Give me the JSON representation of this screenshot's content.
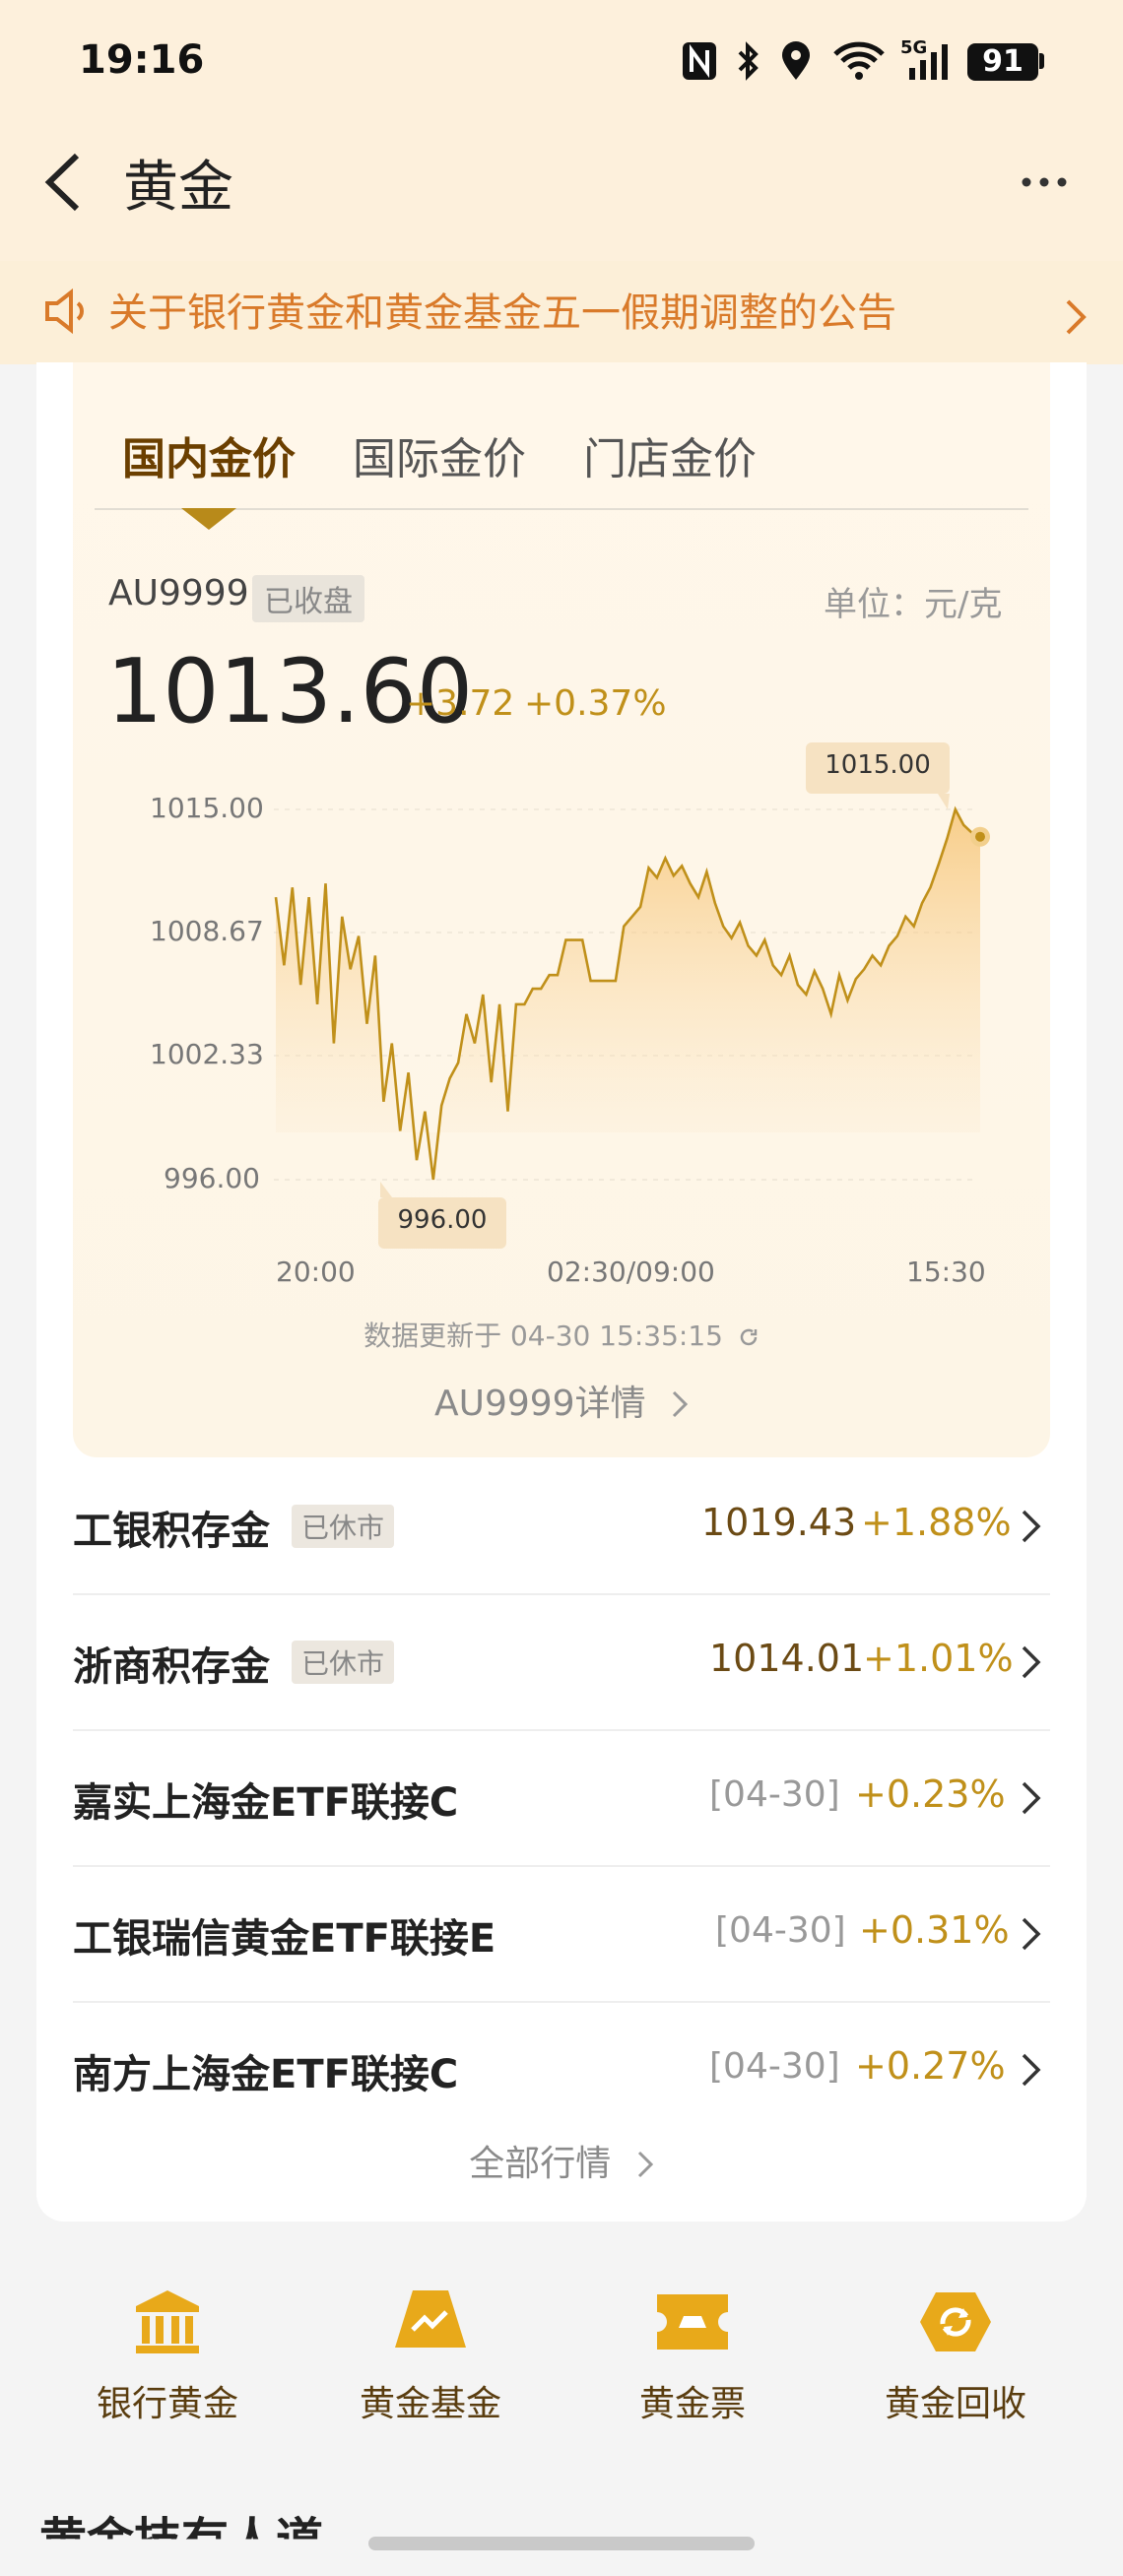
{
  "status_bar": {
    "time": "19:16",
    "network": "5G",
    "battery": "91"
  },
  "header": {
    "title": "黄金"
  },
  "notice": {
    "text": "关于银行黄金和黄金基金五一假期调整的公告"
  },
  "tabs": [
    {
      "label": "国内金价",
      "active": true
    },
    {
      "label": "国际金价",
      "active": false
    },
    {
      "label": "门店金价",
      "active": false
    }
  ],
  "quote": {
    "symbol": "AU9999",
    "market_status": "已收盘",
    "unit": "单位：元/克",
    "price": "1013.60",
    "change": "+3.72",
    "change_pct": "+0.37%"
  },
  "chart_data": {
    "type": "area",
    "y_ticks": [
      "1015.00",
      "1008.67",
      "1002.33",
      "996.00"
    ],
    "x_ticks": [
      "20:00",
      "02:30/09:00",
      "15:30"
    ],
    "ylim": [
      996.0,
      1015.0
    ],
    "max_label": "1015.00",
    "min_label": "996.00",
    "series": [
      {
        "values": [
          1010.5,
          1007.0,
          1011.0,
          1006.0,
          1010.5,
          1005.0,
          1011.2,
          1003.0,
          1009.5,
          1006.8,
          1008.5,
          1004.0,
          1007.5,
          1000.0,
          1003.0,
          998.5,
          1001.5,
          997.0,
          999.5,
          996.0,
          999.8,
          1001.2,
          1002.0,
          1004.5,
          1003.0,
          1005.5,
          1001.0,
          1005.0,
          999.5,
          1005.0,
          1005.0,
          1005.8,
          1005.8,
          1006.5,
          1006.5,
          1008.3,
          1008.3,
          1008.3,
          1006.2,
          1006.2,
          1006.2,
          1006.2,
          1009.0,
          1009.5,
          1010.0,
          1012.0,
          1011.5,
          1012.5,
          1011.6,
          1012.1,
          1011.2,
          1010.5,
          1011.8,
          1010.2,
          1009.0,
          1008.4,
          1009.2,
          1008.0,
          1007.5,
          1008.3,
          1007.0,
          1006.5,
          1007.5,
          1006.0,
          1005.5,
          1006.7,
          1005.8,
          1004.5,
          1006.5,
          1005.2,
          1006.3,
          1006.8,
          1007.5,
          1007.0,
          1008.0,
          1008.5,
          1009.5,
          1009.0,
          1010.2,
          1011.0,
          1012.2,
          1013.5,
          1015.0,
          1014.2,
          1013.8,
          1013.6
        ]
      }
    ]
  },
  "update": {
    "text": "数据更新于 04-30 15:35:15"
  },
  "detail_link": {
    "label": "AU9999详情"
  },
  "products": [
    {
      "name": "工银积存金",
      "badge": "已休市",
      "value": "1019.43",
      "date": "",
      "pct": "+1.88%"
    },
    {
      "name": "浙商积存金",
      "badge": "已休市",
      "value": "1014.01",
      "date": "",
      "pct": "+1.01%"
    },
    {
      "name": "嘉实上海金ETF联接C",
      "badge": "",
      "value": "",
      "date": "[04-30]",
      "pct": "+0.23%"
    },
    {
      "name": "工银瑞信黄金ETF联接E",
      "badge": "",
      "value": "",
      "date": "[04-30]",
      "pct": "+0.31%"
    },
    {
      "name": "南方上海金ETF联接C",
      "badge": "",
      "value": "",
      "date": "[04-30]",
      "pct": "+0.27%"
    }
  ],
  "all_market": {
    "label": "全部行情"
  },
  "bottom_nav": [
    {
      "label": "银行黄金",
      "icon": "bank-icon"
    },
    {
      "label": "黄金基金",
      "icon": "fund-icon"
    },
    {
      "label": "黄金票",
      "icon": "ticket-icon"
    },
    {
      "label": "黄金回收",
      "icon": "recycle-icon"
    }
  ],
  "next_section": {
    "heading": "黄金技有人道"
  },
  "colors": {
    "accent": "#c0901a",
    "header_bg": "#fdf0dc",
    "notice_text": "#d97a2a",
    "icon_gold": "#e8a91a"
  }
}
